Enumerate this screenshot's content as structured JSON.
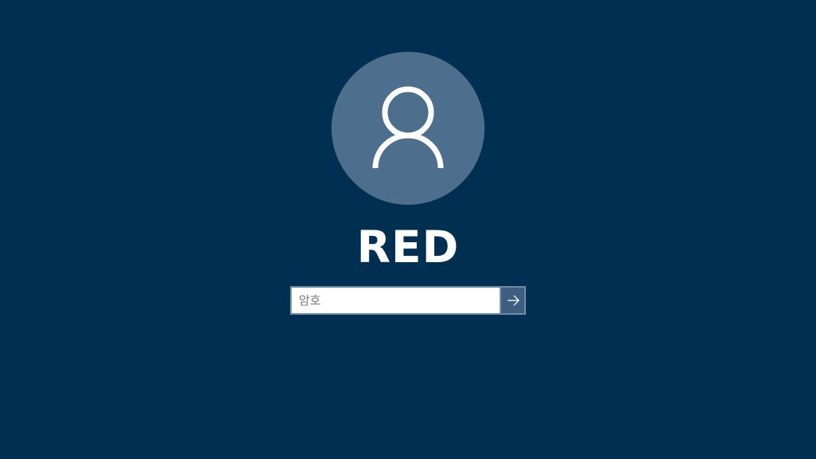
{
  "user": {
    "name": "RED",
    "avatar_icon": "user-silhouette-icon"
  },
  "password": {
    "placeholder": "암호",
    "value": ""
  },
  "submit": {
    "icon": "arrow-right-icon"
  },
  "colors": {
    "background": "#003051",
    "avatar_circle": "#4d6e8d",
    "submit_button": "#3d5e80",
    "input_border": "#6d8aa6",
    "text": "#ffffff"
  }
}
